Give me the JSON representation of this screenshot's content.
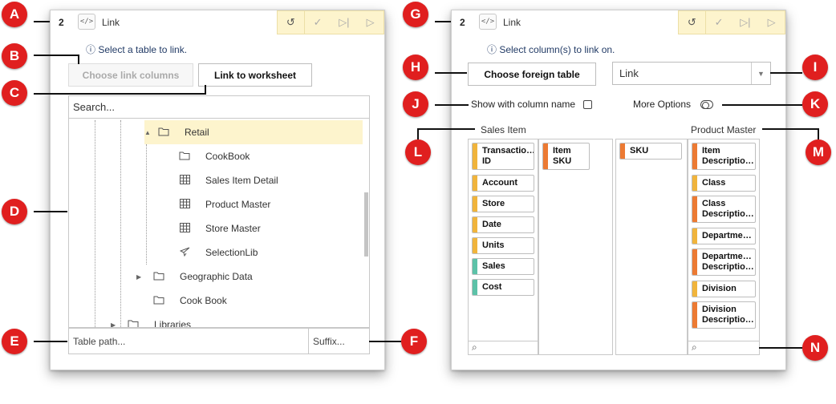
{
  "left_cell": {
    "number": "2",
    "type_label": "Link",
    "info": "ⓘ Select a table to link.",
    "choose_link_columns": "Choose link columns",
    "link_to_worksheet": "Link to worksheet",
    "search_placeholder": "Search...",
    "tree": [
      {
        "label": "Retail",
        "icon": "folder-icon",
        "expanded": true,
        "selected": true
      },
      {
        "label": "CookBook",
        "icon": "folder-icon"
      },
      {
        "label": "Sales Item Detail",
        "icon": "table-icon"
      },
      {
        "label": "Product Master",
        "icon": "table-icon"
      },
      {
        "label": "Store Master",
        "icon": "table-icon"
      },
      {
        "label": "SelectionLib",
        "icon": "paper-plane-icon"
      },
      {
        "label": "Geographic Data",
        "icon": "folder-icon"
      },
      {
        "label": "Cook Book",
        "icon": "folder-icon"
      },
      {
        "label": "Libraries",
        "icon": "folder-icon"
      }
    ],
    "table_path_placeholder": "Table path...",
    "suffix_placeholder": "Suffix..."
  },
  "right_cell": {
    "number": "2",
    "type_label": "Link",
    "info": "ⓘ Select column(s) to link on.",
    "choose_foreign_table": "Choose foreign table",
    "link_type_value": "Link",
    "show_with_column_name": "Show with column name",
    "more_options": "More Options",
    "left_table_title": "Sales Item",
    "right_table_title": "Product Master",
    "sales_item_columns": [
      {
        "label": "Transactio…\nID",
        "color": "#f0b43c"
      },
      {
        "label": "Account",
        "color": "#f0b43c"
      },
      {
        "label": "Store",
        "color": "#f0b43c"
      },
      {
        "label": "Date",
        "color": "#f0b43c"
      },
      {
        "label": "Units",
        "color": "#f0b43c"
      },
      {
        "label": "Sales",
        "color": "#5cc2a8"
      },
      {
        "label": "Cost",
        "color": "#5cc2a8"
      }
    ],
    "sales_item_linked": [
      {
        "label": "Item\nSKU",
        "color": "#ec7a33"
      }
    ],
    "product_linked": [
      {
        "label": "SKU",
        "color": "#ec7a33"
      }
    ],
    "product_columns": [
      {
        "label": "Item\nDescriptio…",
        "color": "#ec7a33"
      },
      {
        "label": "Class",
        "color": "#f0b43c"
      },
      {
        "label": "Class\nDescriptio…",
        "color": "#ec7a33"
      },
      {
        "label": "Departme…",
        "color": "#f0b43c"
      },
      {
        "label": "Departme…\nDescriptio…",
        "color": "#ec7a33"
      },
      {
        "label": "Division",
        "color": "#f0b43c"
      },
      {
        "label": "Division\nDescriptio…",
        "color": "#ec7a33"
      }
    ]
  },
  "callouts": [
    "A",
    "B",
    "C",
    "D",
    "E",
    "F",
    "G",
    "H",
    "I",
    "J",
    "K",
    "L",
    "M",
    "N"
  ]
}
